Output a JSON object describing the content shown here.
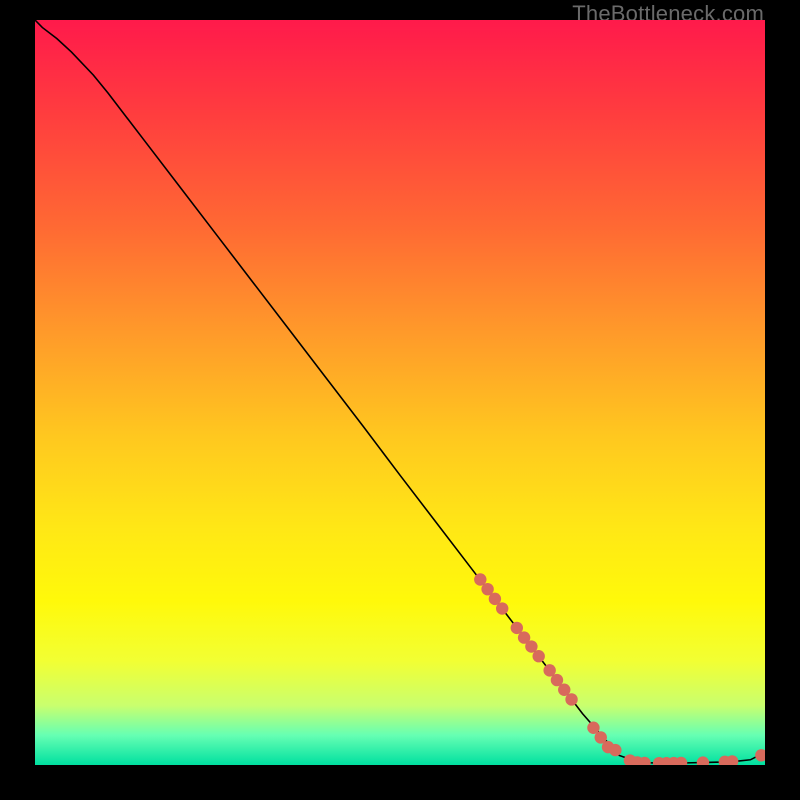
{
  "watermark": "TheBottleneck.com",
  "colors": {
    "gradient_top": "#ff1a4b",
    "gradient_bottom": "#00e0a0",
    "curve": "#000000",
    "points": "#d86a5c",
    "frame": "#000000"
  },
  "chart_data": {
    "type": "line",
    "title": "",
    "xlabel": "",
    "ylabel": "",
    "xlim": [
      0,
      100
    ],
    "ylim": [
      0,
      100
    ],
    "grid": false,
    "legend": false,
    "curve": {
      "x": [
        0,
        1,
        3,
        5,
        8,
        10,
        15,
        20,
        25,
        30,
        35,
        40,
        45,
        50,
        55,
        60,
        65,
        70,
        75,
        80,
        82,
        84,
        86,
        88,
        90,
        92,
        94,
        96,
        98,
        100
      ],
      "y": [
        100,
        99,
        97.5,
        95.7,
        92.6,
        90.2,
        83.8,
        77.4,
        71.0,
        64.6,
        58.2,
        51.8,
        45.4,
        38.9,
        32.5,
        26.1,
        19.7,
        13.3,
        6.9,
        1.3,
        0.6,
        0.3,
        0.25,
        0.25,
        0.3,
        0.35,
        0.4,
        0.5,
        0.7,
        1.7
      ]
    },
    "series": [
      {
        "name": "points",
        "type": "scatter",
        "x": [
          61,
          62,
          63,
          64,
          66,
          67,
          68,
          69,
          70.5,
          71.5,
          72.5,
          73.5,
          76.5,
          77.5,
          78.5,
          79.5,
          81.5,
          82.5,
          83.5,
          85.5,
          86.5,
          87.5,
          88.5,
          91.5,
          94.5,
          95.5,
          99.5
        ],
        "y": [
          24.9,
          23.6,
          22.3,
          21.0,
          18.4,
          17.1,
          15.9,
          14.6,
          12.7,
          11.4,
          10.1,
          8.8,
          5.0,
          3.7,
          2.4,
          2.0,
          0.6,
          0.35,
          0.28,
          0.25,
          0.25,
          0.26,
          0.28,
          0.32,
          0.42,
          0.48,
          1.3
        ]
      }
    ]
  }
}
